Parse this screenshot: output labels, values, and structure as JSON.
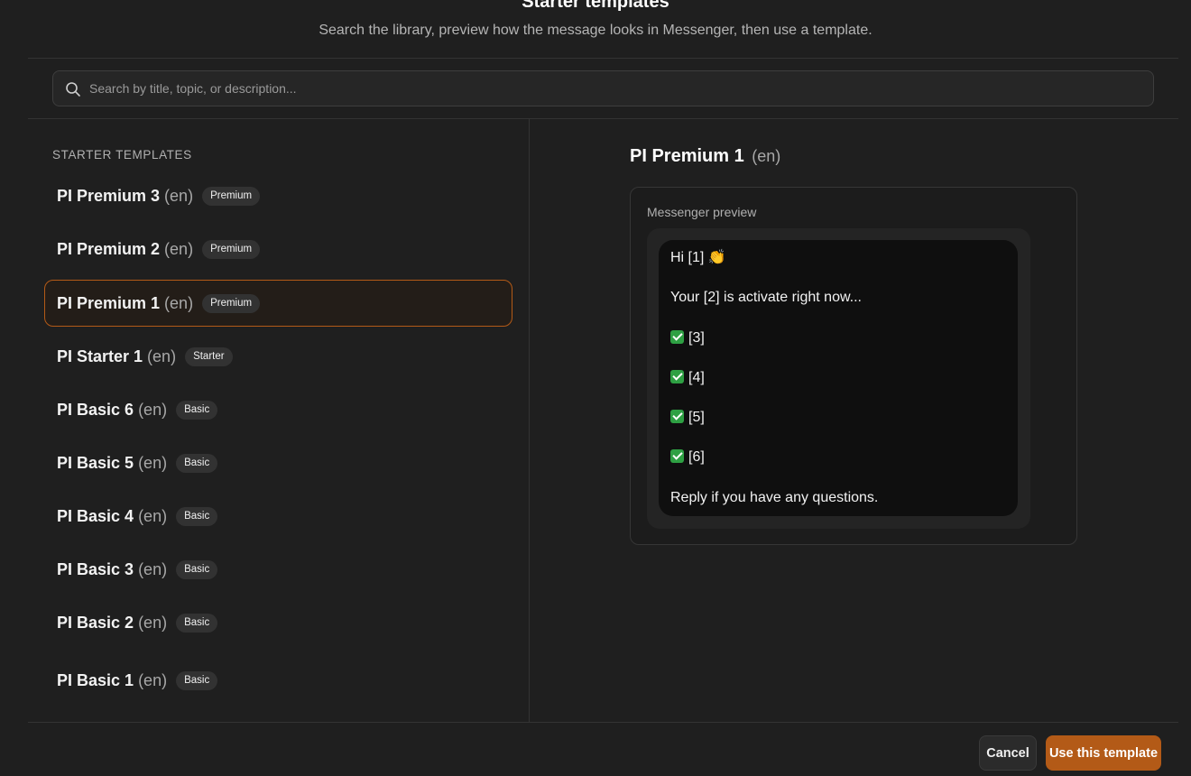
{
  "header": {
    "title": "Starter templates",
    "subtitle": "Search the library, preview how the message looks in Messenger, then use a template."
  },
  "search": {
    "icon": "search-icon",
    "placeholder": "Search by title, topic, or description...",
    "value": ""
  },
  "list": {
    "section_label": "STARTER TEMPLATES",
    "items": [
      {
        "name": "PI Premium 3",
        "lang": "(en)",
        "badge": "Premium"
      },
      {
        "name": "PI Premium 2",
        "lang": "(en)",
        "badge": "Premium"
      },
      {
        "name": "PI Premium 1",
        "lang": "(en)",
        "badge": "Premium",
        "selected": true
      },
      {
        "name": "PI Starter 1",
        "lang": "(en)",
        "badge": "Starter"
      },
      {
        "name": "PI Basic 6",
        "lang": "(en)",
        "badge": "Basic"
      },
      {
        "name": "PI Basic 5",
        "lang": "(en)",
        "badge": "Basic"
      },
      {
        "name": "PI Basic 4",
        "lang": "(en)",
        "badge": "Basic"
      },
      {
        "name": "PI Basic 3",
        "lang": "(en)",
        "badge": "Basic"
      },
      {
        "name": "PI Basic 2",
        "lang": "(en)",
        "badge": "Basic"
      },
      {
        "name": "PI Basic 1",
        "lang": "(en)",
        "badge": "Basic"
      }
    ]
  },
  "preview": {
    "name": "PI Premium 1",
    "lang": "(en)",
    "label": "Messenger preview",
    "lines": [
      {
        "text": "Hi [1] 👏"
      },
      {
        "text": "Your [2] is activate right now..."
      },
      {
        "text": "[3]",
        "check": true
      },
      {
        "text": "[4]",
        "check": true
      },
      {
        "text": "[5]",
        "check": true
      },
      {
        "text": "[6]",
        "check": true
      },
      {
        "text": "Reply if you have any questions."
      }
    ]
  },
  "footer": {
    "cancel_label": "Cancel",
    "use_label": "Use this template"
  },
  "colors": {
    "accent": "#b35a17",
    "background": "#1f1f1f",
    "bubble": "#0f0f0f",
    "check": "#2ea043"
  }
}
